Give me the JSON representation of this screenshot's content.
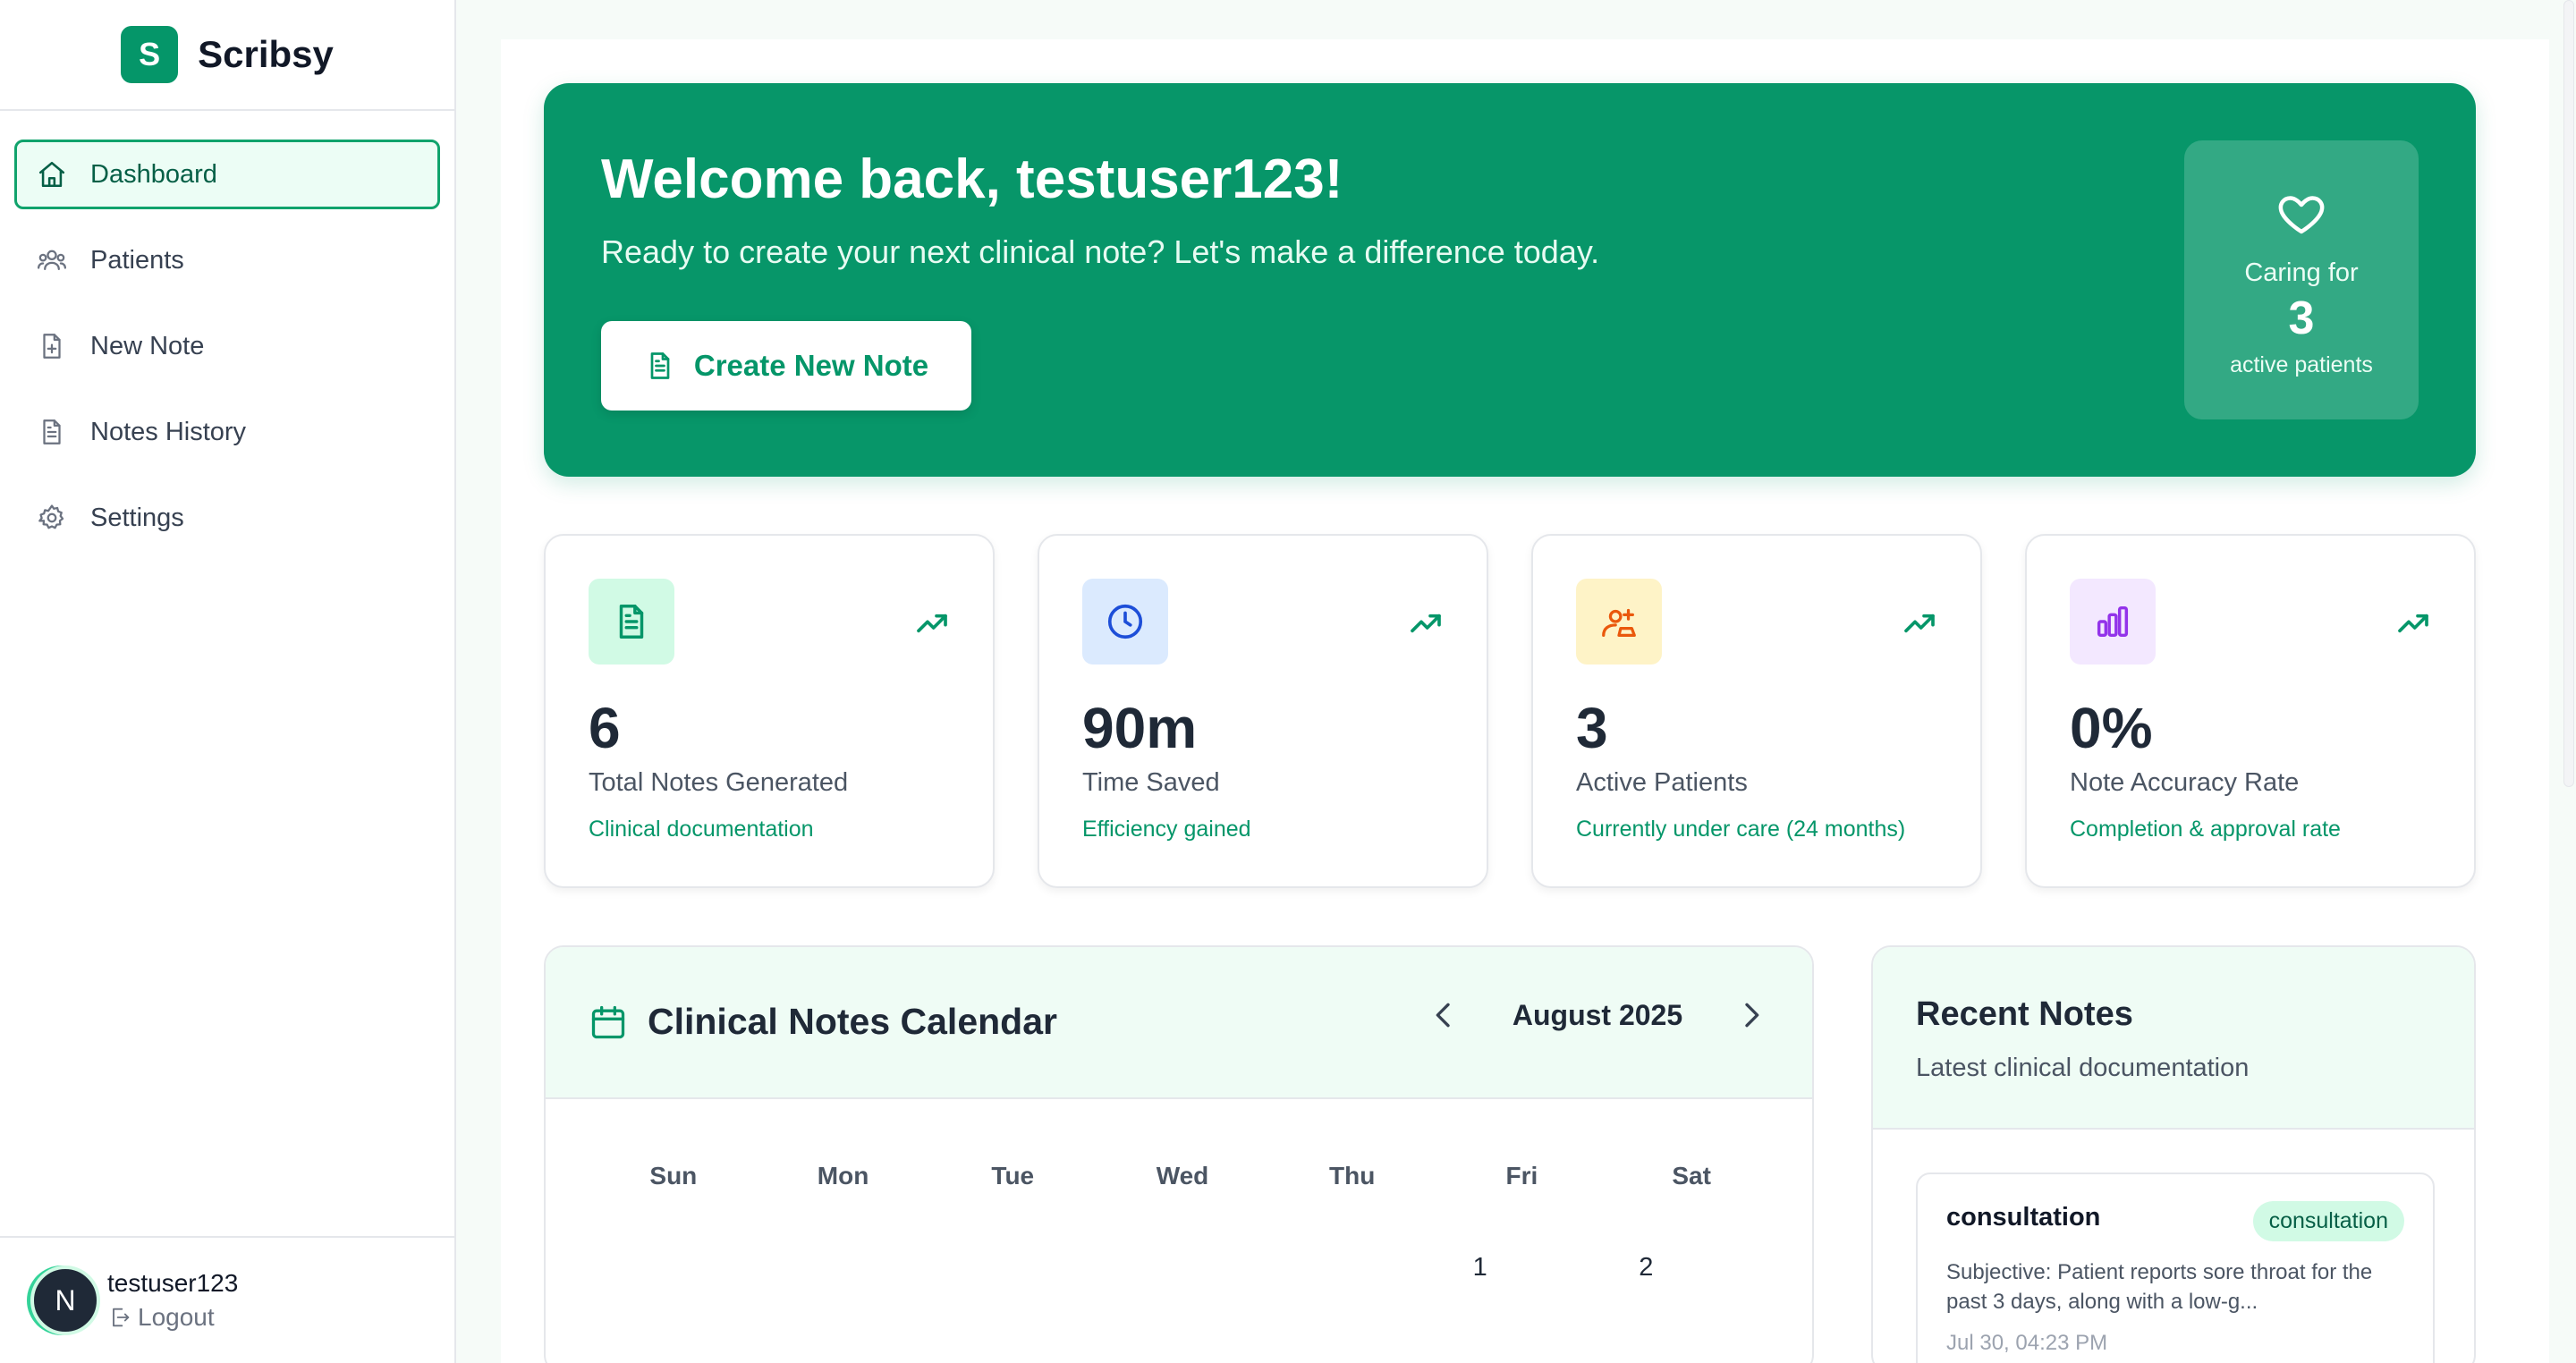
{
  "brand": {
    "logo_letter": "S",
    "name": "Scribsy",
    "accent": "#059669"
  },
  "sidebar": {
    "items": [
      {
        "label": "Dashboard",
        "icon": "home-icon",
        "active": true
      },
      {
        "label": "Patients",
        "icon": "users-icon"
      },
      {
        "label": "New Note",
        "icon": "file-plus-icon"
      },
      {
        "label": "Notes History",
        "icon": "file-text-icon"
      },
      {
        "label": "Settings",
        "icon": "gear-icon"
      }
    ],
    "user": {
      "avatar_letter": "N",
      "name": "testuser123",
      "logout_label": "Logout"
    }
  },
  "hero": {
    "title": "Welcome back, testuser123!",
    "subtitle": "Ready to create your next clinical note? Let's make a difference today.",
    "button_label": "Create New Note",
    "card": {
      "label": "Caring for",
      "count": "3",
      "sub": "active patients"
    }
  },
  "stats": [
    {
      "value": "6",
      "label": "Total Notes Generated",
      "note": "Clinical documentation",
      "icon": "document-icon",
      "icon_bg": "#d1fae5",
      "icon_color": "#059669"
    },
    {
      "value": "90m",
      "label": "Time Saved",
      "note": "Efficiency gained",
      "icon": "clock-icon",
      "icon_bg": "#dbeafe",
      "icon_color": "#1d4ed8"
    },
    {
      "value": "3",
      "label": "Active Patients",
      "note": "Currently under care (24 months)",
      "icon": "patients-icon",
      "icon_bg": "#fef3c7",
      "icon_color": "#ea580c"
    },
    {
      "value": "0%",
      "label": "Note Accuracy Rate",
      "note": "Completion & approval rate",
      "icon": "bar-chart-icon",
      "icon_bg": "#f3e8ff",
      "icon_color": "#9333ea"
    }
  ],
  "calendar": {
    "title": "Clinical Notes Calendar",
    "month": "August 2025",
    "days_of_week": [
      "Sun",
      "Mon",
      "Tue",
      "Wed",
      "Thu",
      "Fri",
      "Sat"
    ],
    "first_row": [
      "",
      "",
      "",
      "",
      "",
      "1",
      "2"
    ]
  },
  "recent_notes": {
    "title": "Recent Notes",
    "subtitle": "Latest clinical documentation",
    "notes": [
      {
        "type": "consultation",
        "badge": "consultation",
        "excerpt": "Subjective: Patient reports sore throat for the past 3 days, along with a low-g...",
        "time": "Jul 30, 04:23 PM"
      }
    ]
  }
}
